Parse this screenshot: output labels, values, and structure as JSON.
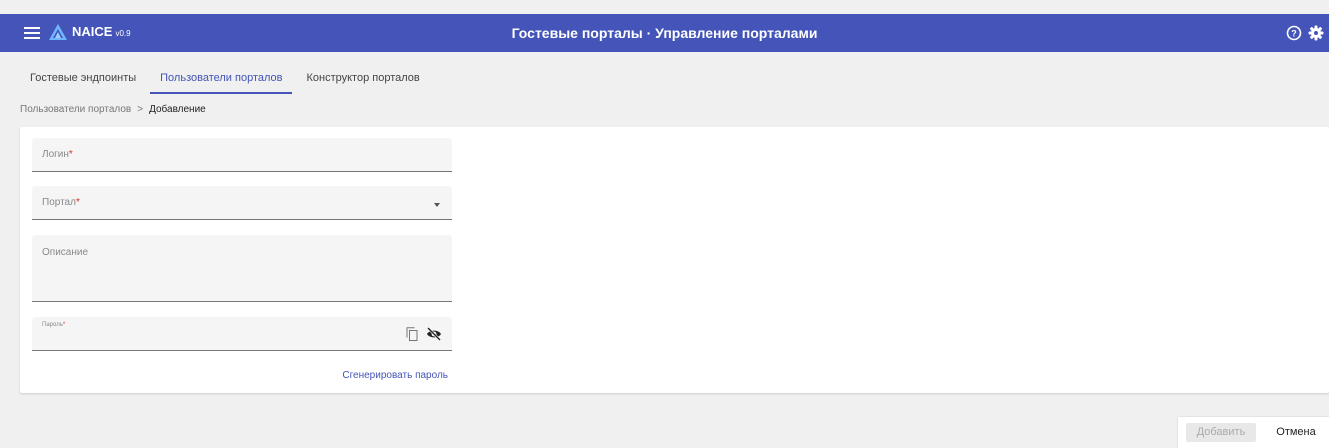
{
  "header": {
    "brand": "NAICE",
    "version": "v0.9",
    "title": "Гостевые порталы · Управление порталами",
    "icons": [
      "menu-icon",
      "logo-icon",
      "help-icon",
      "gear-icon"
    ],
    "background_color": "#4454b8"
  },
  "tabs": [
    {
      "label": "Гостевые эндпоинты",
      "active": false
    },
    {
      "label": "Пользователи порталов",
      "active": true
    },
    {
      "label": "Конструктор порталов",
      "active": false
    }
  ],
  "breadcrumb": {
    "parent": "Пользователи порталов",
    "separator": ">",
    "current": "Добавление"
  },
  "form": {
    "login": {
      "label": "Логин",
      "required_mark": "*",
      "value": ""
    },
    "portal": {
      "label": "Портал",
      "required_mark": "*",
      "value": ""
    },
    "description": {
      "label": "Описание",
      "value": ""
    },
    "password": {
      "label": "Пароль",
      "required_mark": "*",
      "value": "",
      "icons": [
        "copy-icon",
        "eye-off-icon"
      ]
    },
    "generate_link": "Сгенерировать пароль"
  },
  "actions": {
    "add_label": "Добавить",
    "cancel_label": "Отмена"
  },
  "colors": {
    "accent": "#4454b8",
    "required": "#d32f2f"
  }
}
